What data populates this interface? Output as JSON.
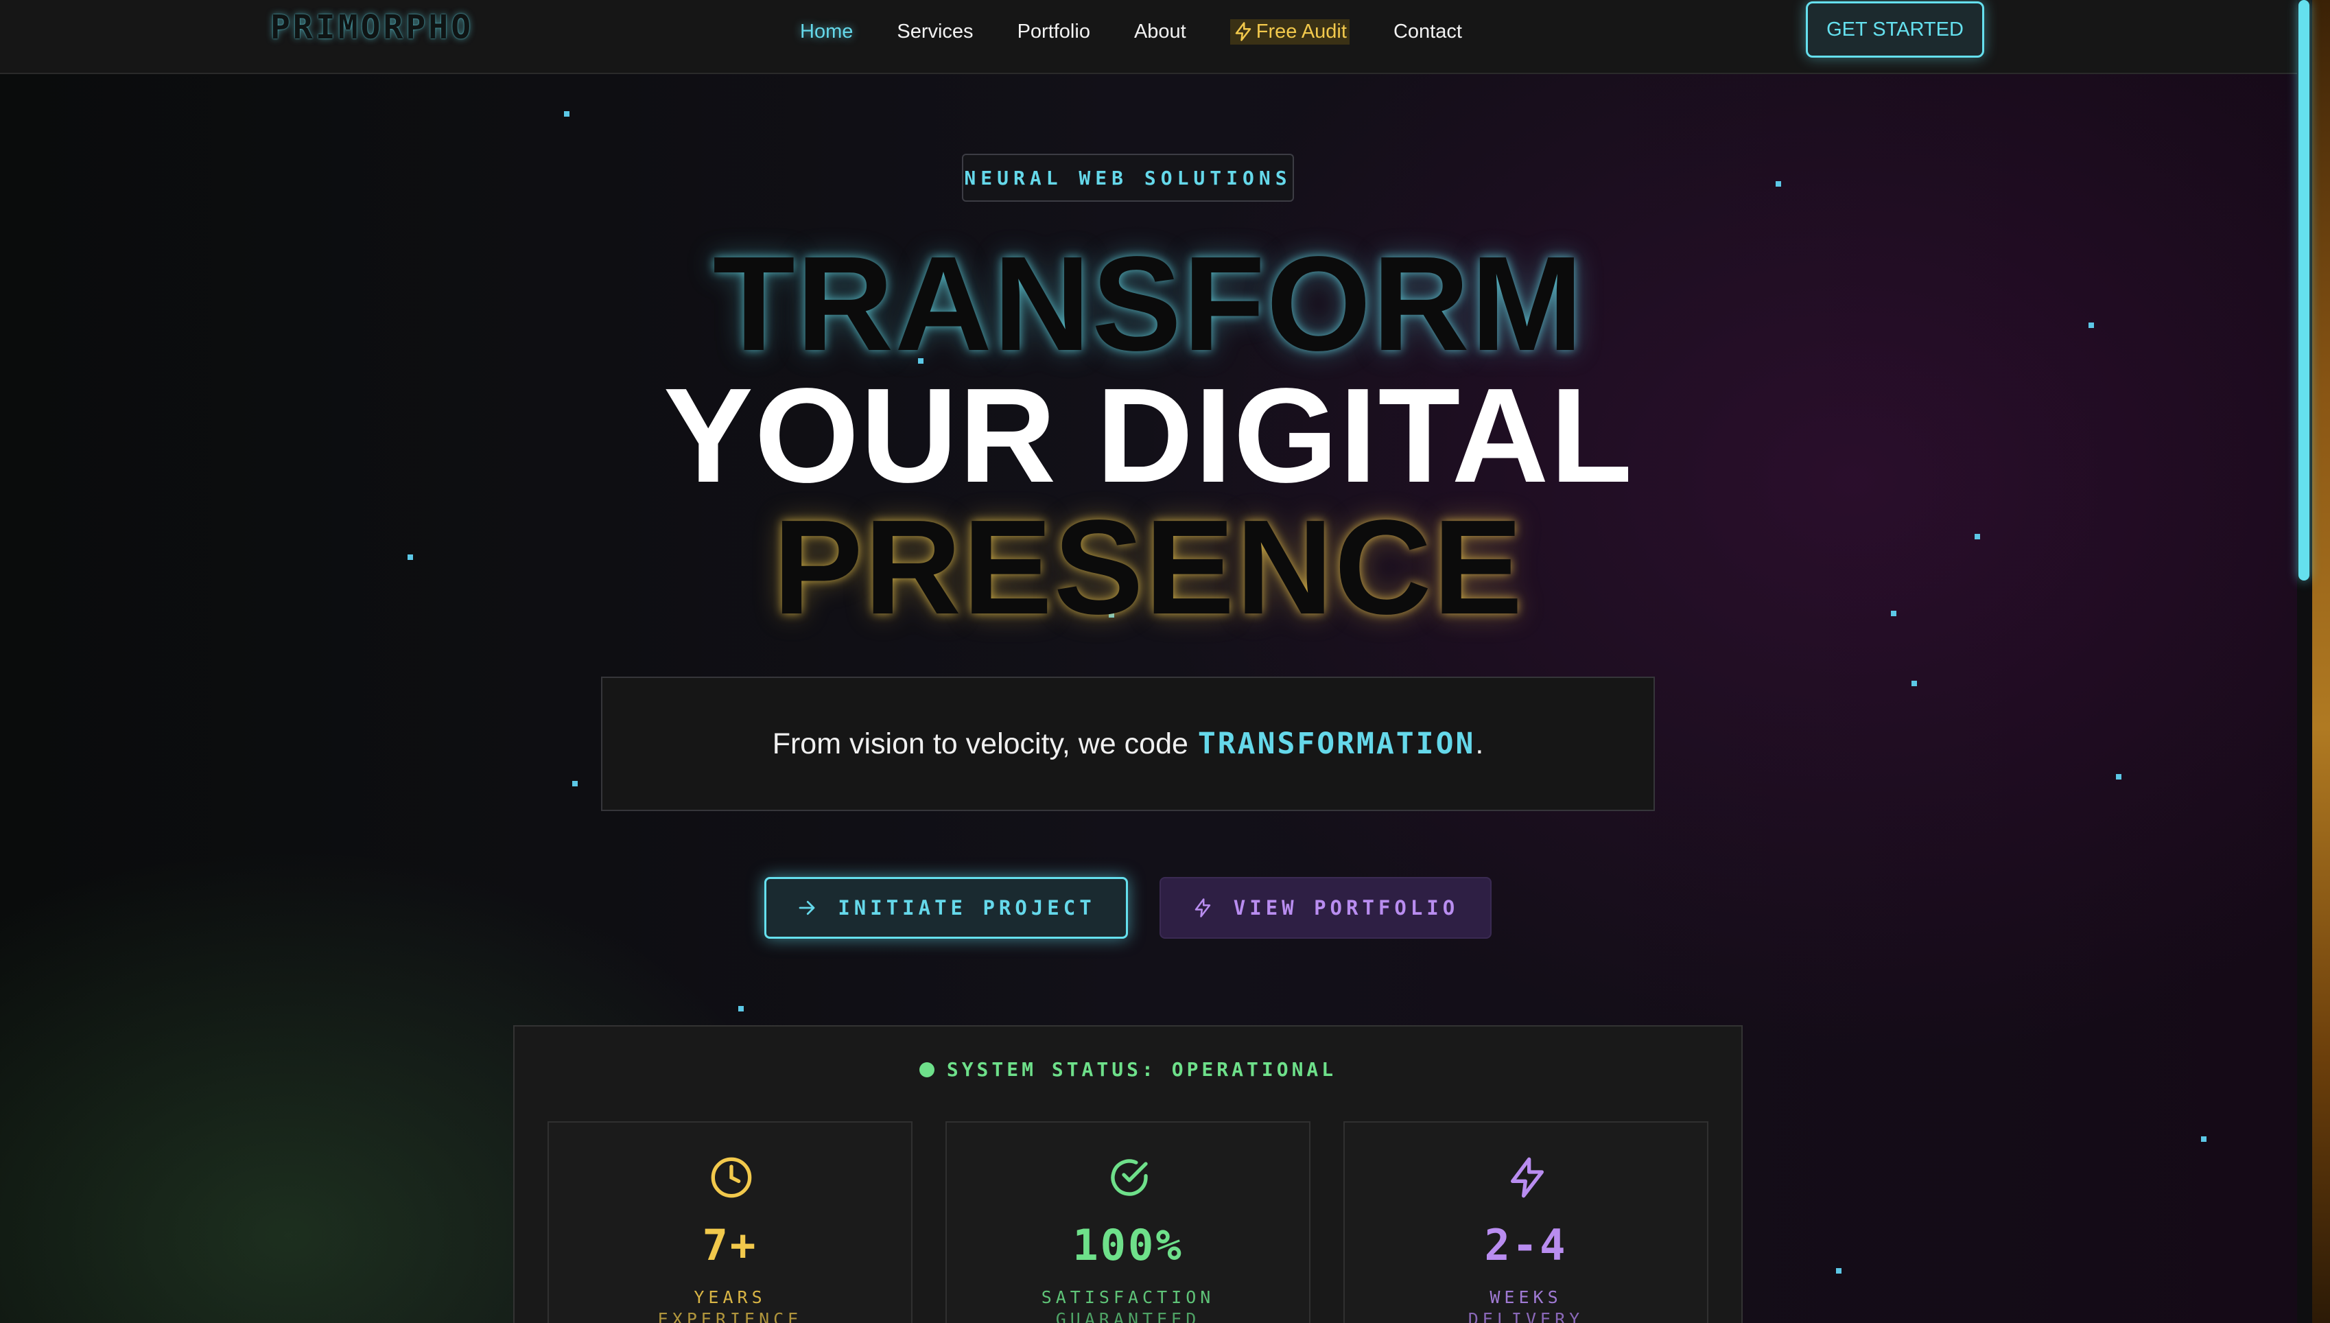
{
  "nav": {
    "logo": "PRIMORPHO",
    "links": [
      {
        "label": "Home",
        "active": true
      },
      {
        "label": "Services"
      },
      {
        "label": "Portfolio"
      },
      {
        "label": "About"
      },
      {
        "label": "Free Audit",
        "icon": "lightning-icon"
      },
      {
        "label": "Contact"
      }
    ],
    "cta": "GET STARTED"
  },
  "hero": {
    "badge": "NEURAL WEB SOLUTIONS",
    "headline_line1": "TRANSFORM",
    "headline_line2": "YOUR DIGITAL",
    "headline_line3": "PRESENCE",
    "tagline_text": "From vision to velocity, we code",
    "tagline_highlight": "TRANSFORMATION",
    "tagline_end": ".",
    "primary_button": "INITIATE PROJECT",
    "primary_icon": "arrow-right-icon",
    "secondary_button": "VIEW PORTFOLIO",
    "secondary_icon": "lightning-icon"
  },
  "status": {
    "label": "SYSTEM STATUS: OPERATIONAL",
    "stats": [
      {
        "icon": "clock-icon",
        "value": "7+",
        "line1": "YEARS",
        "line2": "EXPERIENCE",
        "color": "#f2c94c"
      },
      {
        "icon": "check-circle-icon",
        "value": "100%",
        "line1": "SATISFACTION",
        "line2": "GUARANTEED",
        "color": "#6ee08a"
      },
      {
        "icon": "lightning-icon",
        "value": "2-4",
        "line1": "WEEKS",
        "line2": "DELIVERY",
        "color": "#b98df0"
      }
    ]
  },
  "colors": {
    "accent_cyan": "#65d8ea",
    "accent_yellow": "#f2c94c",
    "accent_green": "#6ee08a",
    "accent_purple": "#b98df0"
  }
}
